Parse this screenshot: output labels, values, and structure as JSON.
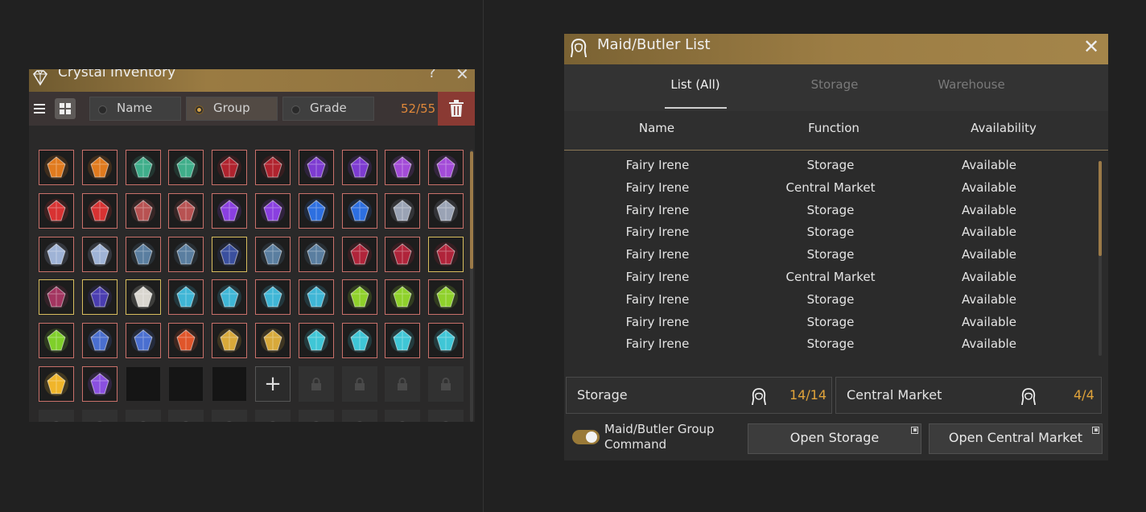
{
  "inventory": {
    "title": "Crystal Inventory",
    "help_glyph": "?",
    "close_glyph": "✕",
    "sort": {
      "name": "Name",
      "group": "Group",
      "grade": "Grade",
      "selected": "Group"
    },
    "count": "52/55",
    "add_glyph": "+",
    "gem_colors": [
      [
        "#e07a1e",
        "#e07a1e",
        "#3fae8a",
        "#3fae8a",
        "#b0232e",
        "#b0232e",
        "#7d3bd1",
        "#7d3bd1",
        "#a34bd8",
        "#a34bd8"
      ],
      [
        "#d83232",
        "#d83232",
        "#b85252",
        "#b85252",
        "#8a3fe0",
        "#8a3fe0",
        "#2d6fe0",
        "#2d6fe0",
        "#9aa3b5",
        "#9aa3b5"
      ],
      [
        "#9fb3d6",
        "#9fb3d6",
        "#5a7ea0",
        "#5a7ea0",
        "#3a4f9e",
        "#5a7ea0",
        "#5a7ea0",
        "#b0243a",
        "#b0243a",
        "#b0243a"
      ],
      [
        "#a33560",
        "#4a3db0",
        "#d9d6cf",
        "#3fb6d6",
        "#3fb6d6",
        "#3fb6d6",
        "#3fb6d6",
        "#8fd12b",
        "#8fd12b",
        "#8fd12b"
      ],
      [
        "#7fcf2a",
        "#4a6fd0",
        "#4a6fd0",
        "#e0552a",
        "#d8a93a",
        "#d8a93a",
        "#3fc6d6",
        "#3fc6d6",
        "#3fc6d6",
        "#3fc6d6"
      ],
      [
        "#f0b52a",
        "#8a4fe0"
      ]
    ]
  },
  "maid": {
    "title": "Maid/Butler List",
    "close_glyph": "✕",
    "tabs": [
      "List (All)",
      "Storage",
      "Warehouse"
    ],
    "columns": [
      "Name",
      "Function",
      "Availability"
    ],
    "rows": [
      {
        "name": "Fairy Irene",
        "function": "Storage",
        "availability": "Available"
      },
      {
        "name": "Fairy Irene",
        "function": "Central Market",
        "availability": "Available"
      },
      {
        "name": "Fairy Irene",
        "function": "Storage",
        "availability": "Available"
      },
      {
        "name": "Fairy Irene",
        "function": "Storage",
        "availability": "Available"
      },
      {
        "name": "Fairy Irene",
        "function": "Storage",
        "availability": "Available"
      },
      {
        "name": "Fairy Irene",
        "function": "Central Market",
        "availability": "Available"
      },
      {
        "name": "Fairy Irene",
        "function": "Storage",
        "availability": "Available"
      },
      {
        "name": "Fairy Irene",
        "function": "Storage",
        "availability": "Available"
      },
      {
        "name": "Fairy Irene",
        "function": "Storage",
        "availability": "Available"
      }
    ],
    "summary": {
      "storage_label": "Storage",
      "storage_value": "14/14",
      "market_label": "Central Market",
      "market_value": "4/4"
    },
    "group_command": "Maid/Butler Group Command",
    "group_command_on": true,
    "open_storage": "Open Storage",
    "open_market": "Open Central Market"
  }
}
